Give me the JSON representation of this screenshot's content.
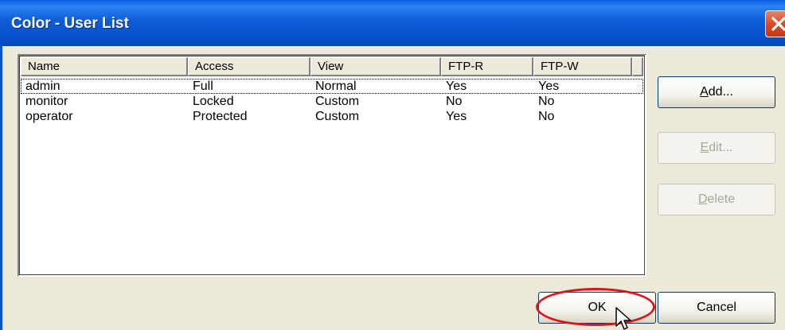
{
  "window": {
    "title": "Color - User List",
    "close_icon": "close-icon"
  },
  "list": {
    "columns": [
      "Name",
      "Access",
      "View",
      "FTP-R",
      "FTP-W"
    ],
    "rows": [
      {
        "name": "admin",
        "access": "Full",
        "view": "Normal",
        "ftp_r": "Yes",
        "ftp_w": "Yes"
      },
      {
        "name": "monitor",
        "access": "Locked",
        "view": "Custom",
        "ftp_r": "No",
        "ftp_w": "No"
      },
      {
        "name": "operator",
        "access": "Protected",
        "view": "Custom",
        "ftp_r": "Yes",
        "ftp_w": "No"
      }
    ]
  },
  "buttons": {
    "add": {
      "pre": "",
      "accel": "A",
      "post": "dd..."
    },
    "edit": {
      "pre": "",
      "accel": "E",
      "post": "dit..."
    },
    "delete": {
      "pre": "",
      "accel": "D",
      "post": "elete"
    },
    "ok": "OK",
    "cancel": "Cancel"
  },
  "colors": {
    "titlebar": "#0550c8",
    "dialog_face": "#ece9d8",
    "highlight_ring": "#e0121b",
    "close_button": "#d9502c"
  }
}
